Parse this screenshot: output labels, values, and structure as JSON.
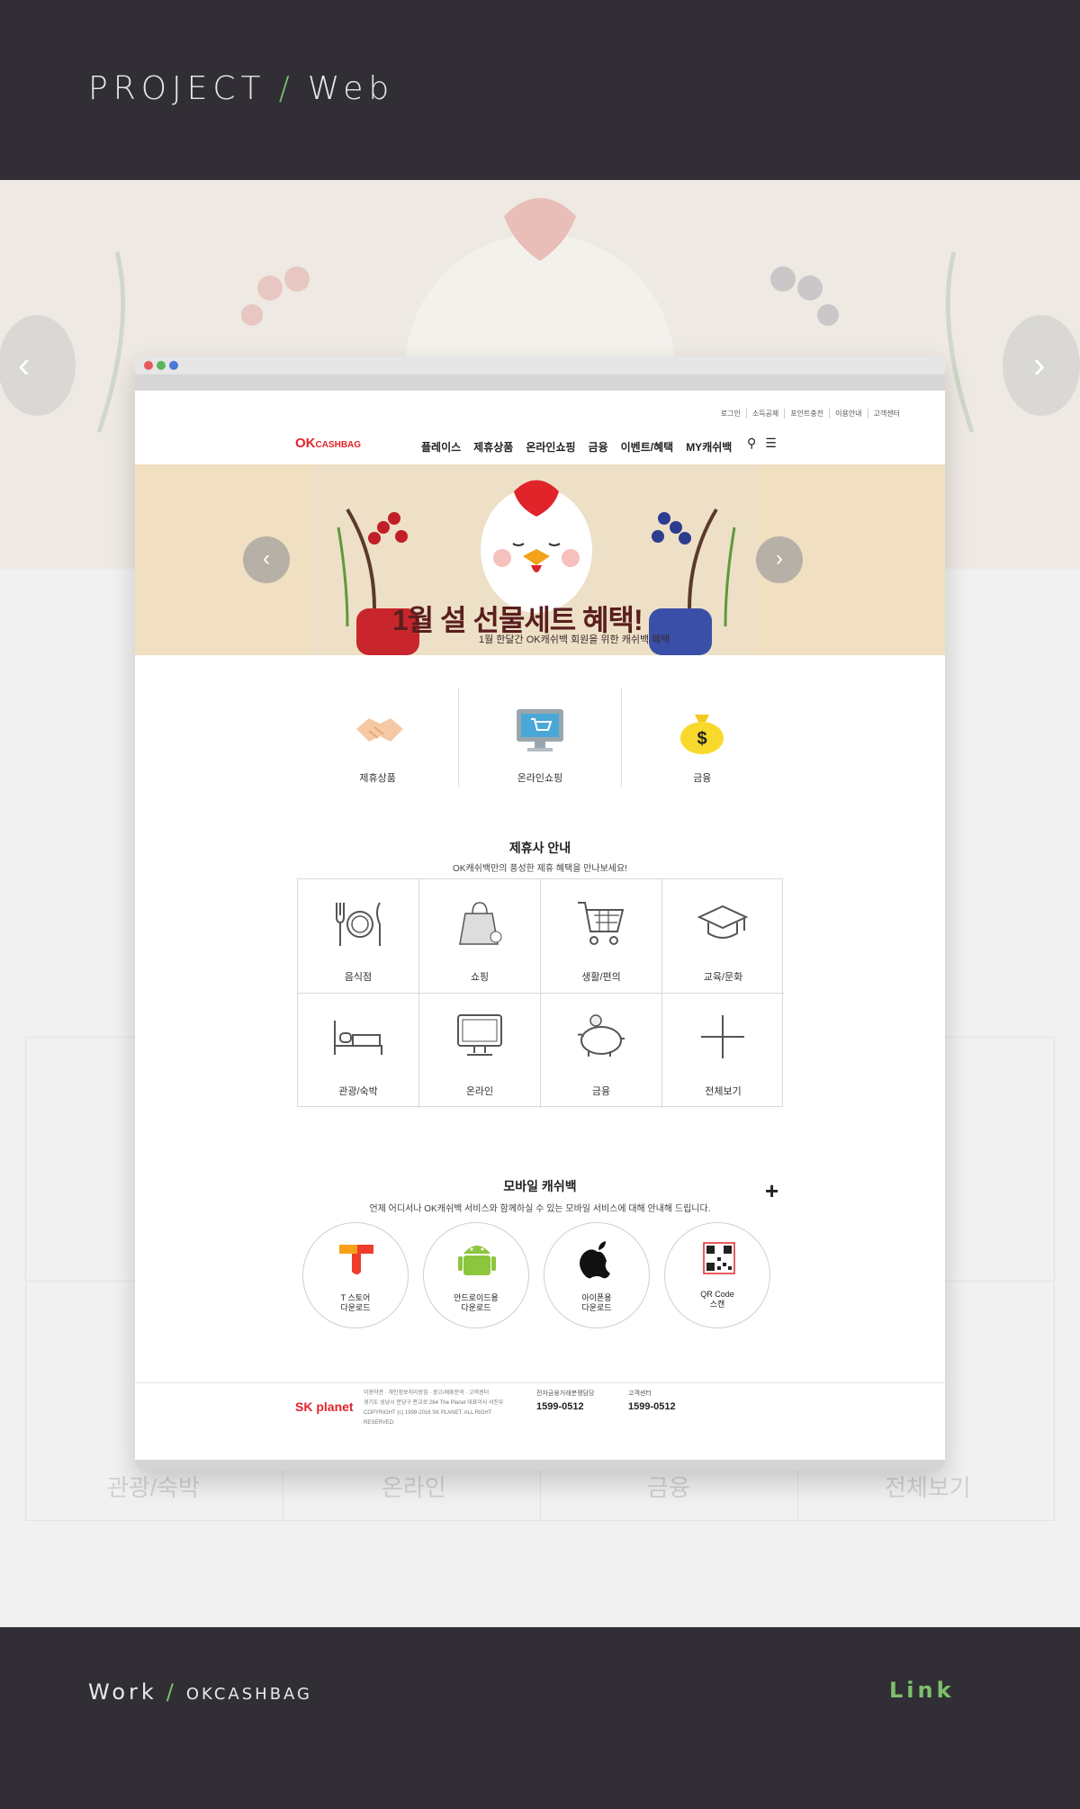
{
  "header": {
    "project_label": "PROJECT",
    "slash": "/",
    "project_type": "Web"
  },
  "browser": {
    "util_nav": [
      "로그인",
      "소득공제",
      "포인트충전",
      "이용안내",
      "고객센터"
    ],
    "logo": {
      "mark": "OK",
      "text": "CASHBAG"
    },
    "gnb": [
      "플레이스",
      "제휴상품",
      "온라인쇼핑",
      "금융",
      "이벤트/혜택",
      "MY캐쉬백"
    ],
    "banner": {
      "title": "1월 설 선물세트 혜택!",
      "subtitle": "1월 한달간 OK캐쉬백 회원을 위한 캐쉬백 혜택"
    },
    "quick_menu": [
      "제휴상품",
      "온라인쇼핑",
      "금융"
    ],
    "partners": {
      "title": "제휴사 안내",
      "subtitle": "OK캐쉬백만의 풍성한 제휴 혜택을 만나보세요!",
      "items": [
        "음식점",
        "쇼핑",
        "생활/편의",
        "교육/문화",
        "관광/숙박",
        "온라인",
        "금융",
        "전체보기"
      ]
    },
    "mobile": {
      "title": "모바일 캐쉬백",
      "subtitle": "언제 어디서나 OK캐쉬백 서비스와 함께하실 수 있는 모바일 서비스에 대해 안내해 드립니다.",
      "apps": [
        {
          "line1": "T 스토어",
          "line2": "다운로드"
        },
        {
          "line1": "안드로이드용",
          "line2": "다운로드"
        },
        {
          "line1": "아이폰용",
          "line2": "다운로드"
        },
        {
          "line1": "QR Code",
          "line2": "스캔"
        }
      ]
    },
    "footer": {
      "brand": "SK planet",
      "links": "이용약관 · 개인정보처리방침 · 광고/제휴문의 · 고객센터",
      "address": "경기도 성남시 분당구 판교로 264 The Planet 대표이사 서진우",
      "copyright": "COPYRIGHT (c) 1999-2016 SK PLANET. ALL RIGHT RESERVED.",
      "cs1_label": "전자금융거래분쟁담당",
      "cs1_phone": "1599-0512",
      "cs2_label": "고객센터",
      "cs2_phone": "1599-0512"
    }
  },
  "ghost_labels": [
    "관광/숙박",
    "온라인",
    "금융",
    "전체보기"
  ],
  "bottom": {
    "work_label": "Work",
    "slash": "/",
    "work_name": "OKCASHBAG",
    "link_label": "Link"
  },
  "colors": {
    "band": "#312f35",
    "accent": "#7cc16a",
    "brand": "#e3232b"
  }
}
